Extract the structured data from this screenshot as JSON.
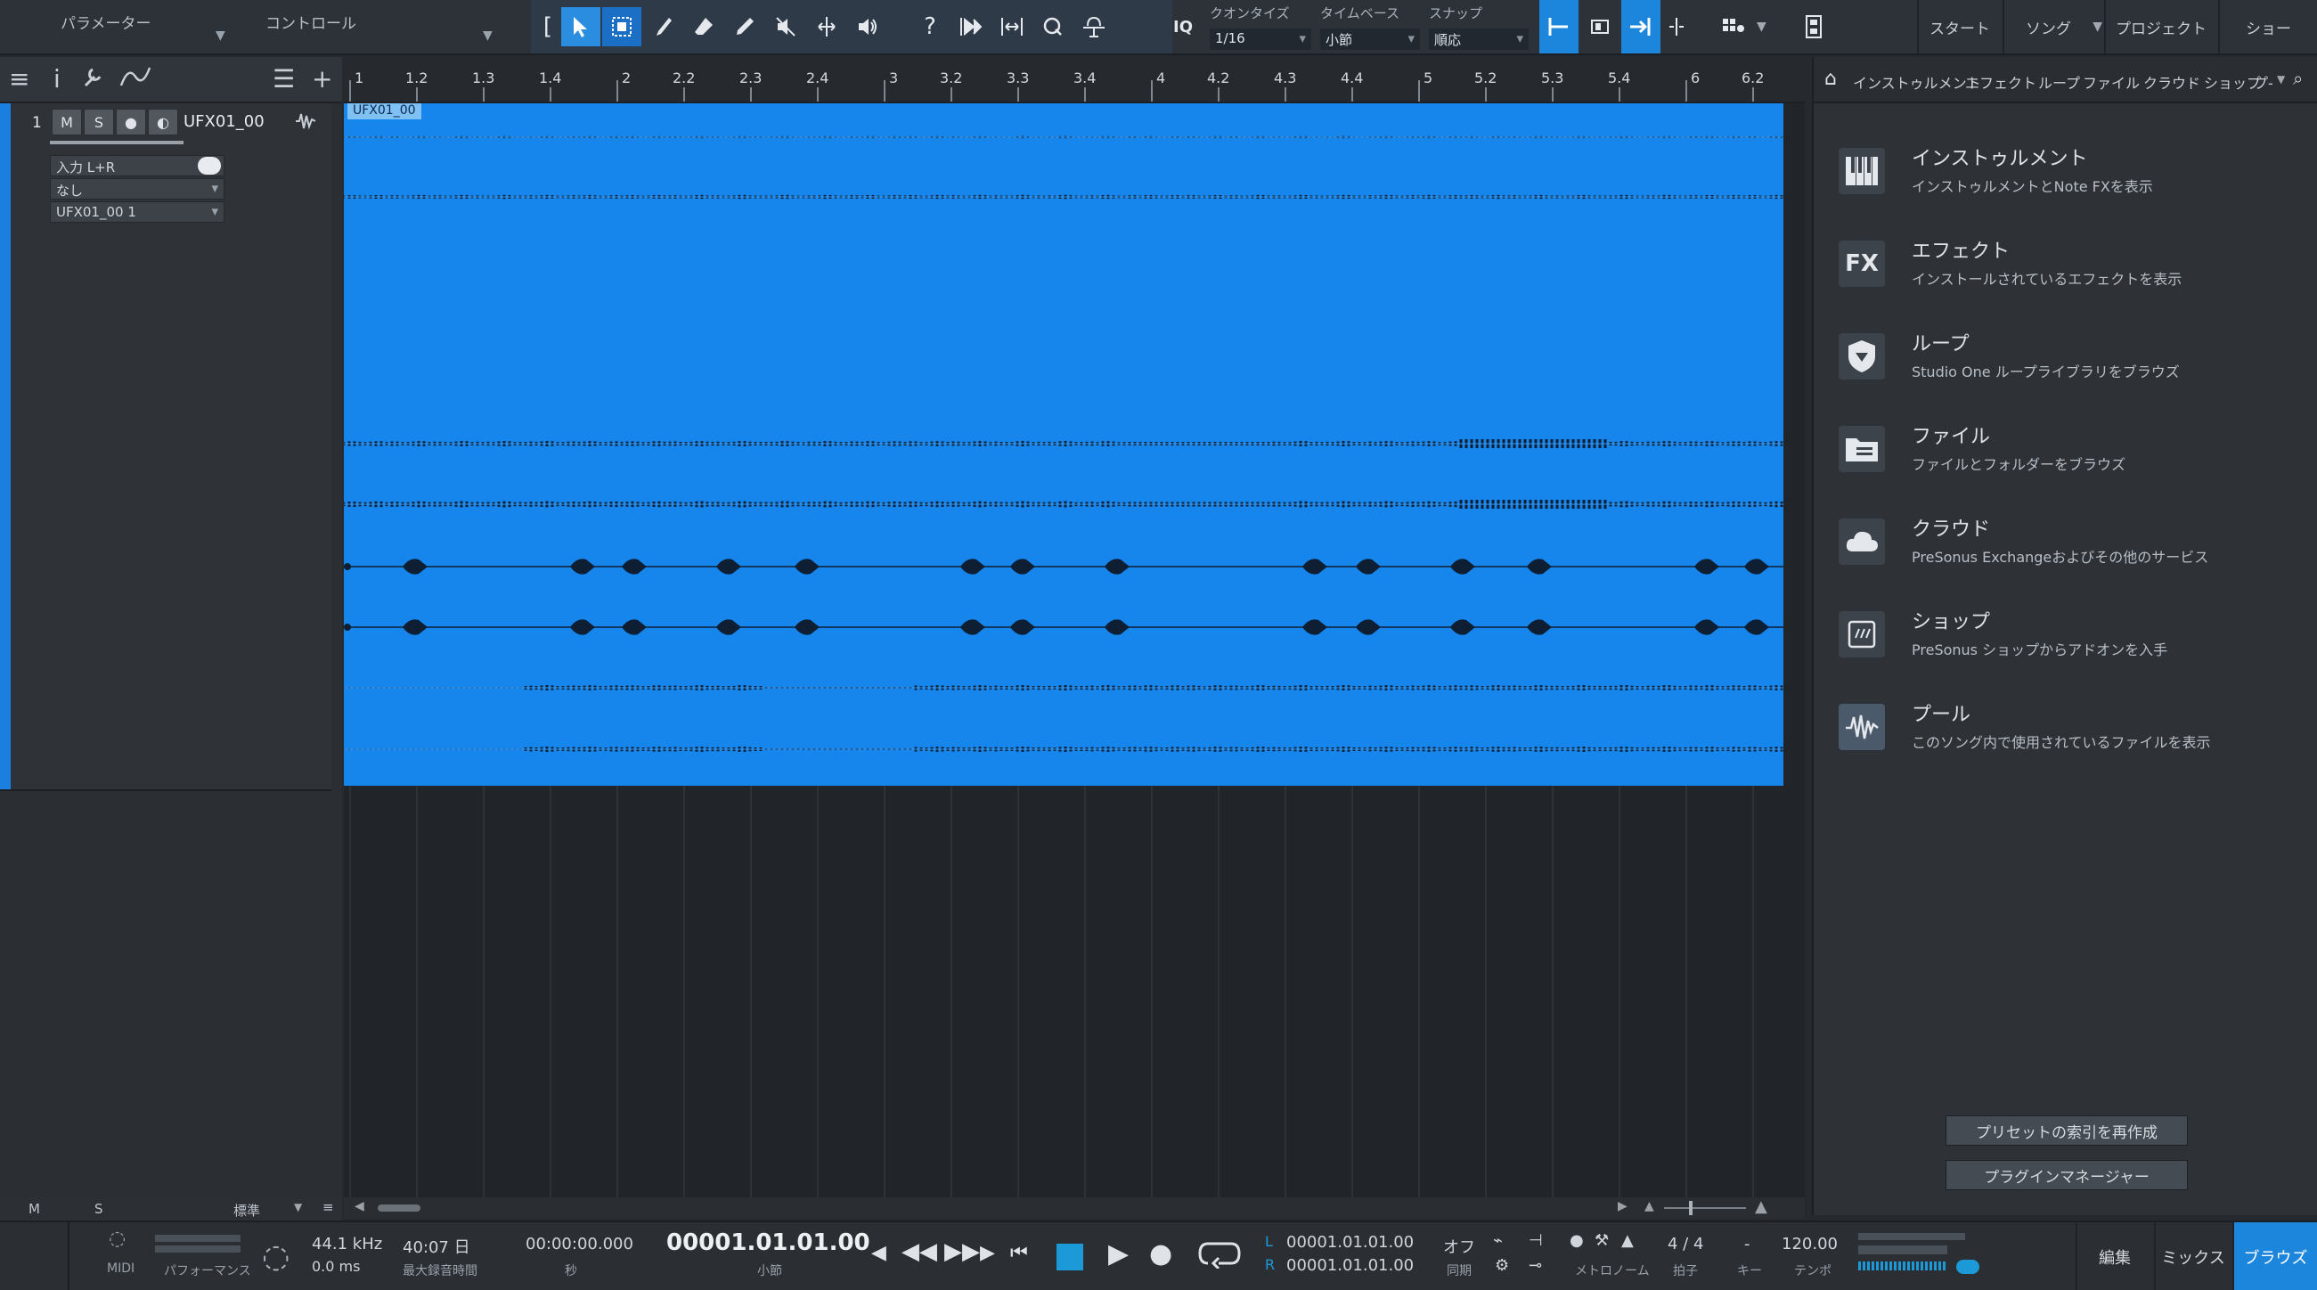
{
  "toolbar": {
    "params_label": "パラメーター",
    "control_label": "コントロール",
    "quantize_label": "クオンタイズ",
    "quantize_value": "1/16",
    "timebase_label": "タイムベース",
    "timebase_value": "小節",
    "snap_label": "スナップ",
    "snap_value": "順応",
    "iq_label": "IQ",
    "nav": {
      "start": "スタート",
      "song": "ソング",
      "project": "プロジェクト",
      "show": "ショー"
    }
  },
  "ruler": {
    "ticks": [
      "1",
      "1.2",
      "1.3",
      "1.4",
      "2",
      "2.2",
      "2.3",
      "2.4",
      "3",
      "3.2",
      "3.3",
      "3.4",
      "4",
      "4.2",
      "4.3",
      "4.4",
      "5",
      "5.2",
      "5.3",
      "5.4",
      "6",
      "6.2"
    ]
  },
  "track": {
    "number": "1",
    "mute": "M",
    "solo": "S",
    "name": "UFX01_00",
    "input": "入力 L+R",
    "output": "なし",
    "channel": "UFX01_00 1",
    "footer_m": "M",
    "footer_s": "S",
    "footer_mode": "標準"
  },
  "event": {
    "name": "UFX01_00"
  },
  "browser": {
    "tabs": [
      "インストゥルメント",
      "エフェクト",
      "ループ",
      "ファイル",
      "クラウド",
      "ショップ",
      "プ-"
    ],
    "categories": [
      {
        "title": "インストゥルメント",
        "desc": "インストゥルメントとNote FXを表示",
        "icon": "piano-icon"
      },
      {
        "title": "エフェクト",
        "desc": "インストールされているエフェクトを表示",
        "icon": "fx-icon"
      },
      {
        "title": "ループ",
        "desc": "Studio One ループライブラリをブラウズ",
        "icon": "loop-icon"
      },
      {
        "title": "ファイル",
        "desc": "ファイルとフォルダーをブラウズ",
        "icon": "folder-icon"
      },
      {
        "title": "クラウド",
        "desc": "PreSonus Exchangeおよびその他のサービス",
        "icon": "cloud-icon"
      },
      {
        "title": "ショップ",
        "desc": "PreSonus ショップからアドオンを入手",
        "icon": "shop-icon"
      },
      {
        "title": "プール",
        "desc": "このソング内で使用されているファイルを表示",
        "icon": "pool-icon"
      }
    ],
    "fx_icon_text": "FX",
    "reindex_button": "プリセットの索引を再作成",
    "plugin_manager_button": "プラグインマネージャー"
  },
  "transport": {
    "midi": "MIDI",
    "performance": "パフォーマンス",
    "sample_rate": "44.1 kHz",
    "latency": "0.0 ms",
    "record_time": "40:07 日",
    "record_time_label": "最大録音時間",
    "time_seconds": "00:00:00.000",
    "time_seconds_label": "秒",
    "position": "00001.01.01.00",
    "position_label": "小節",
    "loop_l_label": "L",
    "loop_l": "00001.01.01.00",
    "loop_r_label": "R",
    "loop_r": "00001.01.01.00",
    "sync_value": "オフ",
    "sync_label": "同期",
    "metronome_label": "メトロノーム",
    "time_sig": "4 / 4",
    "time_sig_label": "拍子",
    "key_value": "-",
    "key_label": "キー",
    "tempo": "120.00",
    "tempo_label": "テンポ"
  },
  "modes": {
    "edit": "編集",
    "mix": "ミックス",
    "browse": "ブラウズ"
  },
  "colors": {
    "accent": "#1b86db",
    "event": "#1685ec",
    "waveform": "#0e1f33"
  }
}
